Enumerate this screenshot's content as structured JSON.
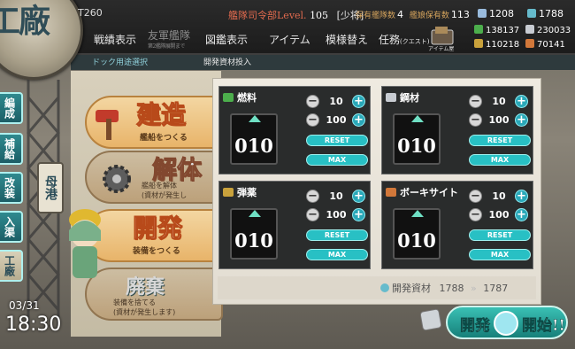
{
  "header": {
    "screen_title": "工廠",
    "player_name": "T260",
    "hq_label": "艦隊司令部Level.",
    "hq_level": "105",
    "hq_rank": "[少将]",
    "ships_label": "保有艦隊数",
    "ships_value": "4",
    "girls_label": "艦娘保有数",
    "girls_value": "113",
    "buckets": "1208",
    "devmats": "1788"
  },
  "nav": {
    "items": [
      {
        "label": "戦績表示"
      },
      {
        "label": "友軍艦隊",
        "sub": "第2艦隊展開まで"
      },
      {
        "label": "図鑑表示"
      },
      {
        "label": "アイテム"
      },
      {
        "label": "模様替え"
      },
      {
        "label": "任務",
        "sub": "(クエスト)"
      }
    ],
    "item_shop_label": "アイテム屋"
  },
  "resources_top": {
    "fuel": "138137",
    "ammo": "110218",
    "steel": "230033",
    "bauxite": "70141"
  },
  "tabs": {
    "left": "ドック用途選択",
    "right": "開発資材投入"
  },
  "side_nav": [
    "編成",
    "補給",
    "改装",
    "入渠",
    "工廠"
  ],
  "port_label": "母港",
  "clock": {
    "date": "03/31",
    "time": "18:30"
  },
  "menu": [
    {
      "title": "建造",
      "sub": "艦船をつくる"
    },
    {
      "title": "解体",
      "sub": "艦船を解体",
      "sub2": "(資材が発生し"
    },
    {
      "title": "開発",
      "sub": "装備をつくる"
    },
    {
      "title": "廃棄",
      "sub": "装備を捨てる",
      "sub2": "(資材が発生します)"
    }
  ],
  "resource_panels": [
    {
      "key": "fuel",
      "label": "燃料",
      "value": "010",
      "step_small": "10",
      "step_large": "100",
      "reset": "RESET",
      "max": "MAX",
      "icon_color": "#4cae4c"
    },
    {
      "key": "steel",
      "label": "鋼材",
      "value": "010",
      "step_small": "10",
      "step_large": "100",
      "reset": "RESET",
      "max": "MAX",
      "icon_color": "#c8ccd2"
    },
    {
      "key": "ammo",
      "label": "弾薬",
      "value": "010",
      "step_small": "10",
      "step_large": "100",
      "reset": "RESET",
      "max": "MAX",
      "icon_color": "#c9a23c"
    },
    {
      "key": "bauxite",
      "label": "ボーキサイト",
      "value": "010",
      "step_small": "10",
      "step_large": "100",
      "reset": "RESET",
      "max": "MAX",
      "icon_color": "#d2783a"
    }
  ],
  "dev_material": {
    "label": "開発資材",
    "before": "1788",
    "after": "1787"
  },
  "start_button": {
    "label": "開発",
    "label2": "開始!!"
  }
}
